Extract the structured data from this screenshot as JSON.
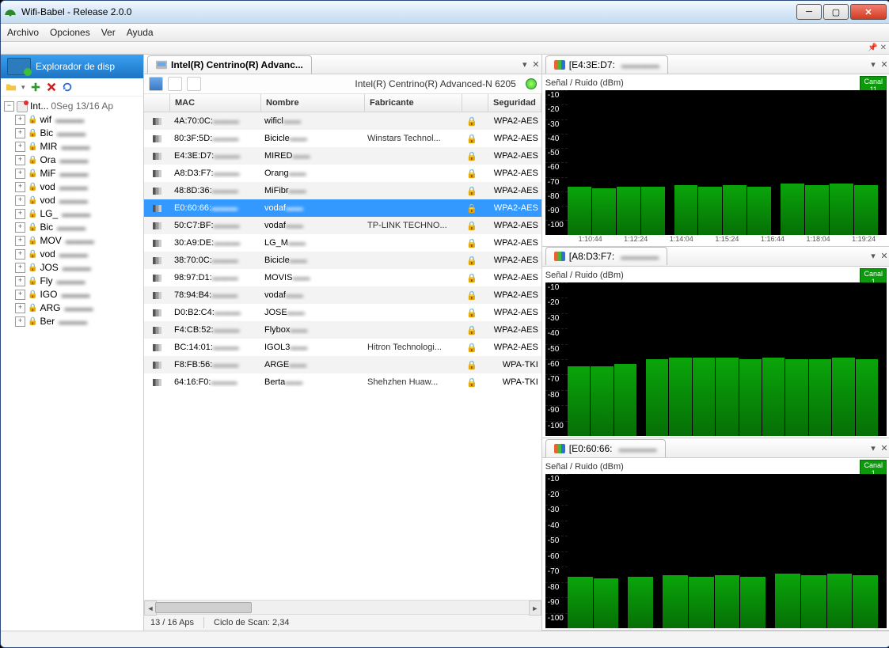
{
  "window": {
    "title": "Wifi-Babel - Release 2.0.0"
  },
  "menu": {
    "file": "Archivo",
    "options": "Opciones",
    "view": "Ver",
    "help": "Ayuda"
  },
  "sidebar": {
    "title": "Explorador de disp",
    "root_label": "Int...",
    "root_meta": "0Seg 13/16 Ap",
    "items": [
      {
        "t": "wif"
      },
      {
        "t": "Bic"
      },
      {
        "t": "MIR"
      },
      {
        "t": "Ora"
      },
      {
        "t": "MiF"
      },
      {
        "t": "vod"
      },
      {
        "t": "vod"
      },
      {
        "t": "LG_"
      },
      {
        "t": "Bic"
      },
      {
        "t": "MOV"
      },
      {
        "t": "vod"
      },
      {
        "t": "JOS"
      },
      {
        "t": "Fly"
      },
      {
        "t": "IGO"
      },
      {
        "t": "ARG"
      },
      {
        "t": "Ber"
      }
    ]
  },
  "center": {
    "tab": "Intel(R) Centrino(R) Advanc...",
    "adapter": "Intel(R) Centrino(R) Advanced-N 6205",
    "headers": {
      "mac": "MAC",
      "name": "Nombre",
      "fab": "Fabricante",
      "sec": "Seguridad"
    },
    "rows": [
      {
        "mac": "4A:70:0C:",
        "name": "wificl",
        "fab": "",
        "sec": "WPA2-AES"
      },
      {
        "mac": "80:3F:5D:",
        "name": "Bicicle",
        "fab": "Winstars Technol...",
        "sec": "WPA2-AES"
      },
      {
        "mac": "E4:3E:D7:",
        "name": "MIRED",
        "fab": "",
        "sec": "WPA2-AES"
      },
      {
        "mac": "A8:D3:F7:",
        "name": "Orang",
        "fab": "",
        "sec": "WPA2-AES"
      },
      {
        "mac": "48:8D:36:",
        "name": "MiFibr",
        "fab": "",
        "sec": "WPA2-AES"
      },
      {
        "mac": "E0:60:66:",
        "name": "vodaf",
        "fab": "",
        "sec": "WPA2-AES",
        "sel": true
      },
      {
        "mac": "50:C7:BF:",
        "name": "vodaf",
        "fab": "TP-LINK TECHNO...",
        "sec": "WPA2-AES"
      },
      {
        "mac": "30:A9:DE:",
        "name": "LG_M",
        "fab": "",
        "sec": "WPA2-AES"
      },
      {
        "mac": "38:70:0C:",
        "name": "Bicicle",
        "fab": "",
        "sec": "WPA2-AES"
      },
      {
        "mac": "98:97:D1:",
        "name": "MOVIS",
        "fab": "",
        "sec": "WPA2-AES"
      },
      {
        "mac": "78:94:B4:",
        "name": "vodaf",
        "fab": "",
        "sec": "WPA2-AES"
      },
      {
        "mac": "D0:B2:C4:",
        "name": "JOSE",
        "fab": "",
        "sec": "WPA2-AES"
      },
      {
        "mac": "F4:CB:52:",
        "name": "Flybox",
        "fab": "",
        "sec": "WPA2-AES"
      },
      {
        "mac": "BC:14:01:",
        "name": "IGOL3",
        "fab": "Hitron Technologi...",
        "sec": "WPA2-AES"
      },
      {
        "mac": "F8:FB:56:",
        "name": "ARGE",
        "fab": "",
        "sec": "WPA-TKI"
      },
      {
        "mac": "64:16:F0:",
        "name": "Berta",
        "fab": "Shehzhen Huaw...",
        "sec": "WPA-TKI"
      }
    ],
    "status": {
      "aps": "13 / 16 Aps",
      "scan": "Ciclo de Scan: 2,34"
    }
  },
  "charts": {
    "snr": "Señal / Ruido (dBm)",
    "canal": "Canal",
    "panes": [
      {
        "tab": "[E4:3E:D7:",
        "ch": "11"
      },
      {
        "tab": "[A8:D3:F7:",
        "ch": "1"
      },
      {
        "tab": "[E0:60:66:",
        "ch": "1"
      }
    ],
    "yticks": [
      "-10",
      "-20",
      "-30",
      "-40",
      "-50",
      "-60",
      "-70",
      "-80",
      "-90",
      "-100"
    ],
    "xticks": [
      "1:10:44",
      "1:12:24",
      "1:14:04",
      "1:15:24",
      "1:16:44",
      "1:18:04",
      "1:19:24"
    ]
  },
  "chart_data": [
    {
      "type": "bar",
      "title": "Señal / Ruido (dBm) — E4:3E:D7",
      "ylabel": "dBm",
      "ylim": [
        -100,
        -10
      ],
      "series": [
        {
          "name": "signal",
          "values": [
            -70,
            -71,
            -70,
            -70,
            0,
            -69,
            -70,
            -69,
            -70,
            0,
            -68,
            -69,
            -68,
            -69,
            0
          ]
        }
      ],
      "categories": [
        "1:10:44",
        "",
        "1:12:24",
        "",
        "",
        "1:14:04",
        "",
        "1:15:24",
        "",
        "",
        "1:16:44",
        "",
        "1:18:04",
        "",
        "1:19:24"
      ]
    },
    {
      "type": "bar",
      "title": "Señal / Ruido (dBm) — A8:D3:F7",
      "ylabel": "dBm",
      "ylim": [
        -100,
        -10
      ],
      "series": [
        {
          "name": "signal",
          "values": [
            -59,
            -59,
            -58,
            0,
            -55,
            -54,
            -54,
            -54,
            -55,
            -54,
            -55,
            -55,
            -54,
            -55,
            0
          ]
        }
      ]
    },
    {
      "type": "bar",
      "title": "Señal / Ruido (dBm) — E0:60:66",
      "ylabel": "dBm",
      "ylim": [
        -100,
        -10
      ],
      "series": [
        {
          "name": "signal",
          "values": [
            -70,
            -71,
            0,
            -70,
            0,
            -69,
            -70,
            -69,
            -70,
            0,
            -68,
            -69,
            -68,
            -69,
            0
          ]
        }
      ]
    }
  ]
}
